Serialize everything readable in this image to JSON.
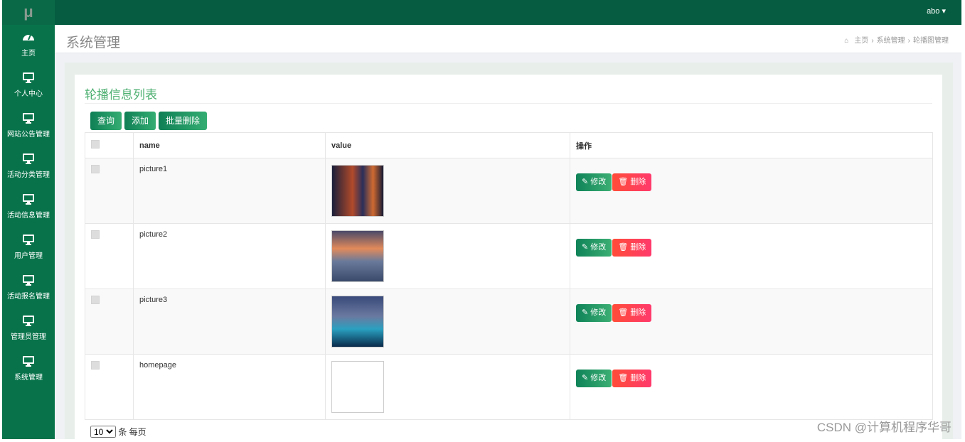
{
  "app": {
    "logo": "μ",
    "user": "abo ▾"
  },
  "sidebar": {
    "items": [
      {
        "label": "主页",
        "icon": "dashboard-icon"
      },
      {
        "label": "个人中心",
        "icon": "monitor-icon"
      },
      {
        "label": "网站公告管理",
        "icon": "monitor-icon"
      },
      {
        "label": "活动分类管理",
        "icon": "monitor-icon"
      },
      {
        "label": "活动信息管理",
        "icon": "monitor-icon"
      },
      {
        "label": "用户管理",
        "icon": "monitor-icon"
      },
      {
        "label": "活动报名管理",
        "icon": "monitor-icon"
      },
      {
        "label": "管理员管理",
        "icon": "monitor-icon"
      },
      {
        "label": "系统管理",
        "icon": "monitor-icon"
      }
    ]
  },
  "header": {
    "title": "系统管理",
    "breadcrumb": [
      "主页",
      "系统管理",
      "轮播图管理"
    ]
  },
  "card": {
    "title": "轮播信息列表",
    "buttons": {
      "query": "查询",
      "add": "添加",
      "batch_delete": "批量删除"
    }
  },
  "table": {
    "headers": {
      "name": "name",
      "value": "value",
      "ops": "操作"
    },
    "rows": [
      {
        "name": "picture1",
        "image": "city-night"
      },
      {
        "name": "picture2",
        "image": "sunset-coast"
      },
      {
        "name": "picture3",
        "image": "bridge-night"
      },
      {
        "name": "homepage",
        "image": "broken"
      }
    ],
    "edit_label": "修改",
    "delete_label": "删除"
  },
  "pager": {
    "page_size": "10",
    "suffix": "条 每页"
  },
  "watermark": "CSDN @计算机程序华哥"
}
